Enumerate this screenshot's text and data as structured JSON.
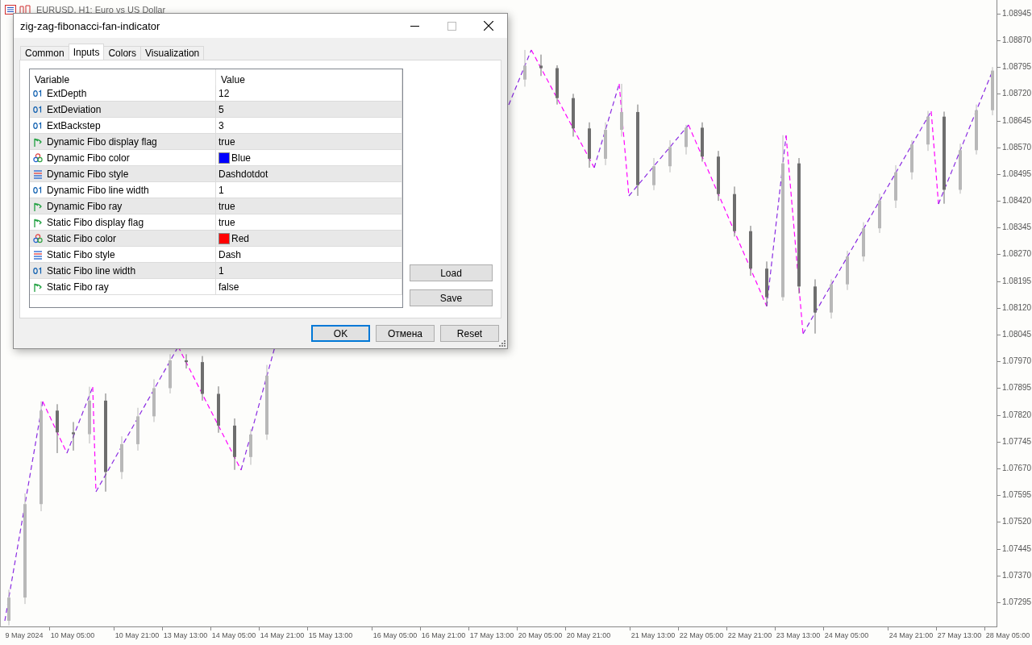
{
  "chart": {
    "title": "EURUSD, H1: Euro vs US Dollar",
    "chart_data": {
      "type": "candlestick",
      "ylim": [
        1.07227,
        1.08983
      ],
      "categories": [
        null,
        "9 May 2024",
        null,
        null,
        "10 May 05:00",
        null,
        null,
        null,
        "10 May 21:00",
        null,
        null,
        "13 May 13:00",
        null,
        null,
        "14 May 05:00",
        null,
        null,
        "14 May 21:00",
        null,
        null,
        "15 May 13:00",
        null,
        null,
        null,
        "16 May 05:00",
        null,
        null,
        "16 May 21:00",
        null,
        null,
        "17 May 13:00",
        null,
        null,
        "20 May 05:00",
        null,
        null,
        "20 May 21:00",
        null,
        null,
        null,
        "21 May 13:00",
        null,
        null,
        "22 May 05:00",
        null,
        null,
        "22 May 21:00",
        null,
        null,
        "23 May 13:00",
        null,
        null,
        "24 May 05:00",
        null,
        null,
        null,
        "24 May 21:00",
        null,
        null,
        "27 May 13:00",
        null,
        null,
        "28 May 05:00"
      ],
      "ohlc": [
        [
          1.07243,
          1.0733,
          1.0723,
          1.07308
        ],
        [
          1.07308,
          1.076,
          1.0729,
          1.0757
        ],
        [
          1.0757,
          1.07858,
          1.0755,
          1.07832
        ],
        [
          1.07832,
          1.0785,
          1.07713,
          1.07771
        ],
        [
          1.07771,
          1.078,
          1.0772,
          1.07766
        ],
        [
          1.07766,
          1.07899,
          1.0774,
          1.0786
        ],
        [
          1.0786,
          1.0788,
          1.07605,
          1.0766
        ],
        [
          1.0766,
          1.0776,
          1.0764,
          1.07738
        ],
        [
          1.07738,
          1.0784,
          1.0772,
          1.07816
        ],
        [
          1.07816,
          1.0792,
          1.078,
          1.07895
        ],
        [
          1.07895,
          1.0799,
          1.0788,
          1.07973
        ],
        [
          1.07973,
          1.0799,
          1.0795,
          1.07968
        ],
        [
          1.07968,
          1.07985,
          1.0786,
          1.07879
        ],
        [
          1.07879,
          1.079,
          1.0777,
          1.0779
        ],
        [
          1.0779,
          1.0781,
          1.07666,
          1.07702
        ],
        [
          1.07702,
          1.0778,
          1.0768,
          1.07765
        ],
        [
          1.07765,
          1.0796,
          1.0775,
          1.0793
        ],
        null,
        null,
        null,
        null,
        null,
        null,
        null,
        null,
        null,
        null,
        null,
        null,
        null,
        null,
        null,
        [
          1.0876,
          1.08843,
          1.0874,
          1.08799
        ],
        [
          1.08799,
          1.0883,
          1.0877,
          1.08792
        ],
        [
          1.08792,
          1.088,
          1.0869,
          1.08708
        ],
        [
          1.08708,
          1.0872,
          1.086,
          1.08623
        ],
        [
          1.08623,
          1.0864,
          1.08513,
          1.08538
        ],
        [
          1.08538,
          1.0864,
          1.0852,
          1.08619
        ],
        [
          1.08619,
          1.08748,
          1.086,
          1.08669
        ],
        [
          1.08669,
          1.0869,
          1.08434,
          1.08464
        ],
        [
          1.08464,
          1.0854,
          1.0845,
          1.08517
        ],
        [
          1.08517,
          1.0859,
          1.085,
          1.08571
        ],
        [
          1.08571,
          1.08633,
          1.0855,
          1.08625
        ],
        [
          1.08625,
          1.0864,
          1.0853,
          1.08544
        ],
        [
          1.08544,
          1.0856,
          1.0842,
          1.08439
        ],
        [
          1.08439,
          1.0846,
          1.0832,
          1.08335
        ],
        [
          1.08335,
          1.0835,
          1.0821,
          1.0823
        ],
        [
          1.0823,
          1.0825,
          1.08125,
          1.0815
        ],
        [
          1.0815,
          1.08604,
          1.0814,
          1.08525
        ],
        [
          1.08525,
          1.0854,
          1.0816,
          1.0818
        ],
        [
          1.0818,
          1.082,
          1.08048,
          1.08107
        ],
        [
          1.08107,
          1.082,
          1.0809,
          1.08186
        ],
        [
          1.08186,
          1.0828,
          1.0817,
          1.08264
        ],
        [
          1.08264,
          1.0836,
          1.0825,
          1.08343
        ],
        [
          1.08343,
          1.0844,
          1.0833,
          1.08421
        ],
        [
          1.08421,
          1.0852,
          1.084,
          1.085
        ],
        [
          1.085,
          1.0859,
          1.0848,
          1.08578
        ],
        [
          1.08578,
          1.08672,
          1.0856,
          1.08656
        ],
        [
          1.08656,
          1.0867,
          1.08412,
          1.08451
        ],
        [
          1.08451,
          1.0858,
          1.0844,
          1.08562
        ],
        [
          1.08562,
          1.0869,
          1.0855,
          1.08674
        ],
        [
          1.08674,
          1.08795,
          1.0866,
          1.08785
        ],
        null
      ],
      "yticks": [
        {
          "value": 1.08945,
          "label": "1.08945"
        },
        {
          "value": 1.0887,
          "label": "1.08870"
        },
        {
          "value": 1.08795,
          "label": "1.08795"
        },
        {
          "value": 1.0872,
          "label": "1.08720"
        },
        {
          "value": 1.08645,
          "label": "1.08645"
        },
        {
          "value": 1.0857,
          "label": "1.08570"
        },
        {
          "value": 1.08495,
          "label": "1.08495"
        },
        {
          "value": 1.0842,
          "label": "1.08420"
        },
        {
          "value": 1.08345,
          "label": "1.08345"
        },
        {
          "value": 1.0827,
          "label": "1.08270"
        },
        {
          "value": 1.08195,
          "label": "1.08195"
        },
        {
          "value": 1.0812,
          "label": "1.08120"
        },
        {
          "value": 1.08045,
          "label": "1.08045"
        },
        {
          "value": 1.0797,
          "label": "1.07970"
        },
        {
          "value": 1.07895,
          "label": "1.07895"
        },
        {
          "value": 1.0782,
          "label": "1.07820"
        },
        {
          "value": 1.07745,
          "label": "1.07745"
        },
        {
          "value": 1.0767,
          "label": "1.07670"
        },
        {
          "value": 1.07595,
          "label": "1.07595"
        },
        {
          "value": 1.0752,
          "label": "1.07520"
        },
        {
          "value": 1.07445,
          "label": "1.07445"
        },
        {
          "value": 1.0737,
          "label": "1.07370"
        },
        {
          "value": 1.07295,
          "label": "1.07295"
        }
      ],
      "ylabel": null
    }
  },
  "dialog": {
    "title": "zig-zag-fibonacci-fan-indicator",
    "tabs": [
      {
        "label": "Common",
        "selected": false
      },
      {
        "label": "Inputs",
        "selected": true
      },
      {
        "label": "Colors",
        "selected": false
      },
      {
        "label": "Visualization",
        "selected": false
      }
    ],
    "table": {
      "columns": [
        "Variable",
        "Value"
      ],
      "rows": [
        {
          "kind": "int",
          "variable": "ExtDepth",
          "value": "12"
        },
        {
          "kind": "int",
          "variable": "ExtDeviation",
          "value": "5"
        },
        {
          "kind": "int",
          "variable": "ExtBackstep",
          "value": "3"
        },
        {
          "kind": "bool",
          "variable": "Dynamic Fibo display flag",
          "value": "true"
        },
        {
          "kind": "color",
          "variable": "Dynamic Fibo color",
          "value": "Blue",
          "color": "#0000ff"
        },
        {
          "kind": "style",
          "variable": "Dynamic Fibo style",
          "value": "Dashdotdot"
        },
        {
          "kind": "int",
          "variable": "Dynamic Fibo line width",
          "value": "1"
        },
        {
          "kind": "bool",
          "variable": "Dynamic Fibo ray",
          "value": "true"
        },
        {
          "kind": "bool",
          "variable": "Static Fibo display flag",
          "value": "true"
        },
        {
          "kind": "color",
          "variable": "Static Fibo color",
          "value": "Red",
          "color": "#ff0000"
        },
        {
          "kind": "style",
          "variable": "Static Fibo style",
          "value": "Dash"
        },
        {
          "kind": "int",
          "variable": "Static Fibo line width",
          "value": "1"
        },
        {
          "kind": "bool",
          "variable": "Static Fibo ray",
          "value": "false"
        }
      ]
    },
    "side_buttons": [
      "Load",
      "Save"
    ],
    "buttons": [
      {
        "label": "OK",
        "default": true
      },
      {
        "label": "Отмена",
        "default": false
      },
      {
        "label": "Reset",
        "default": false
      }
    ]
  }
}
